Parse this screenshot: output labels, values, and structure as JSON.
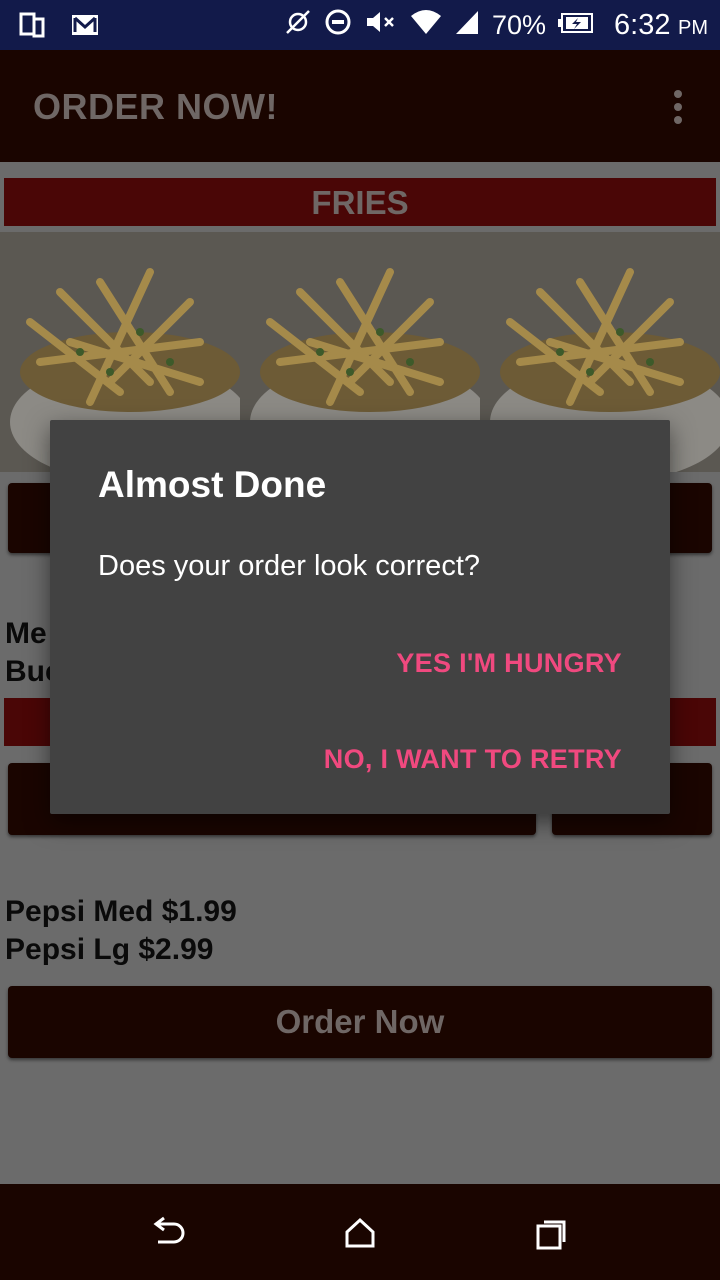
{
  "status_bar": {
    "battery": "70%",
    "time": "6:32",
    "ampm": "PM",
    "icons": [
      "device-icon",
      "gmail-icon",
      "nfc-off-icon",
      "dnd-icon",
      "mute-icon",
      "wifi-icon",
      "signal-icon",
      "battery-charging-icon"
    ]
  },
  "app_bar": {
    "title": "ORDER NOW!",
    "menu_icon": "more-vert-icon"
  },
  "content": {
    "fries_header": "FRIES",
    "fries_image": "fries-photo",
    "partial_text_line1": "Me",
    "partial_text_line2": "Buc",
    "drinks_line1": "Pepsi Med $1.99",
    "drinks_line2": "Pepsi Lg $2.99",
    "order_button": "Order Now"
  },
  "dialog": {
    "title": "Almost Done",
    "message": "Does your order look correct?",
    "positive": "YES I'M HUNGRY",
    "negative": "NO, I WANT TO RETRY",
    "accent": "#f0497f"
  },
  "nav_bar": {
    "icons": [
      "back-icon",
      "home-icon",
      "recents-icon"
    ]
  }
}
